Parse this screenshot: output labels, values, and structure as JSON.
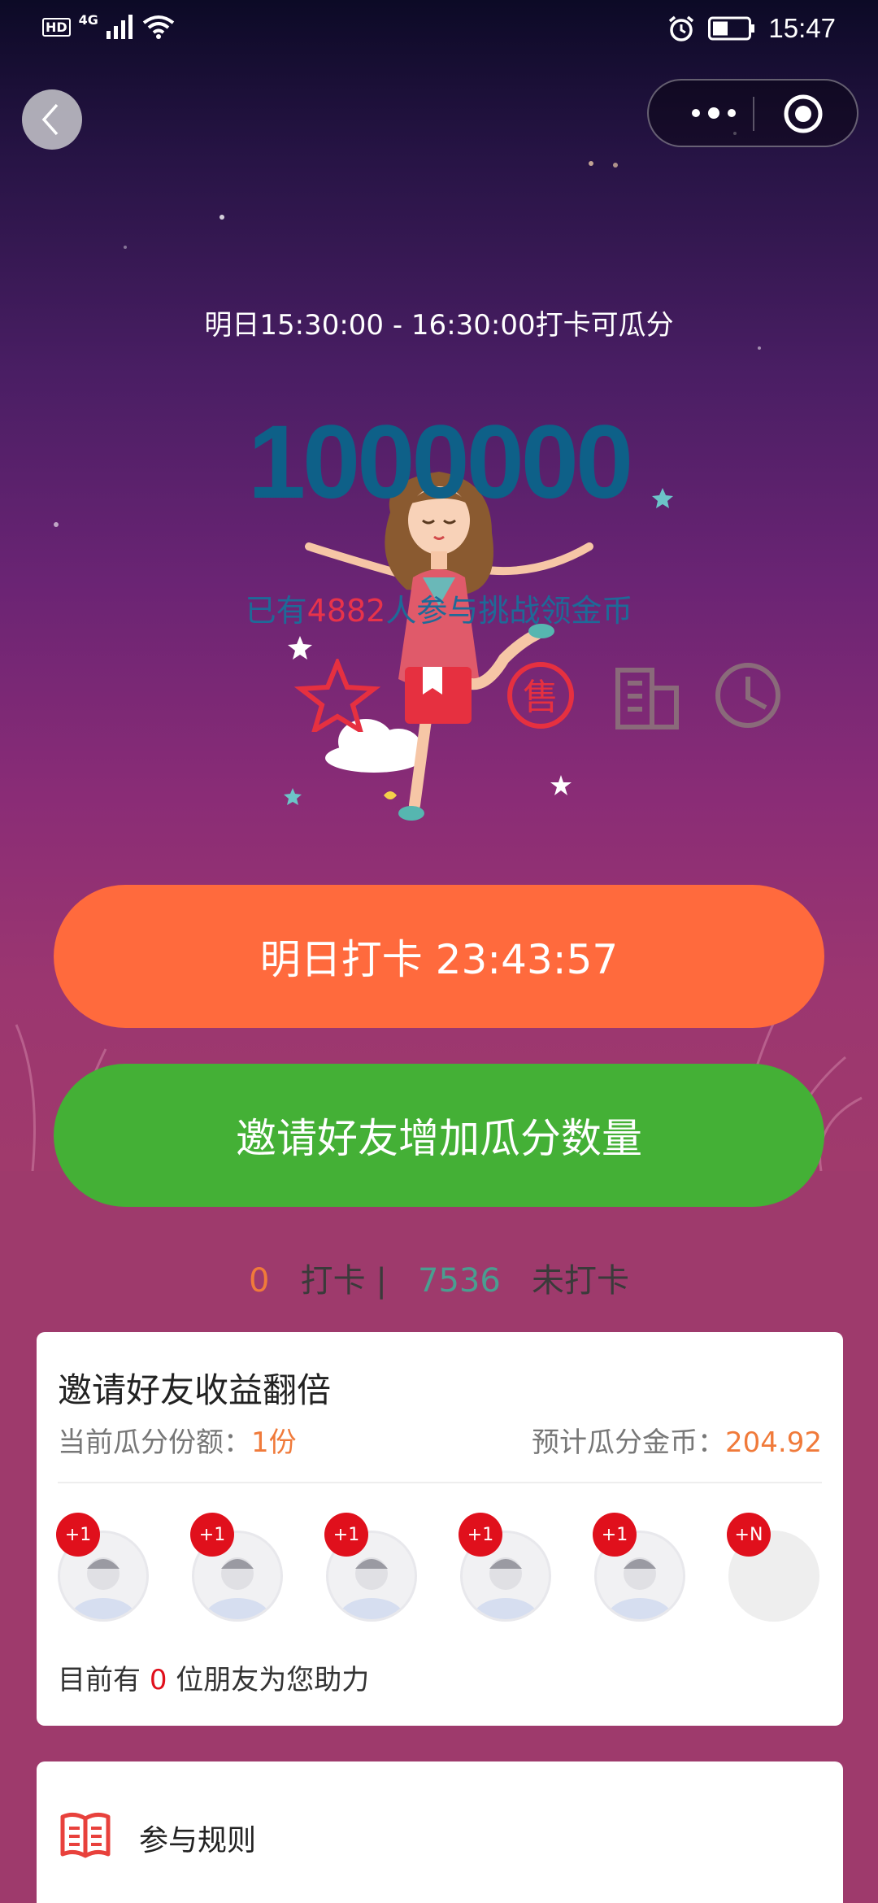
{
  "status_bar": {
    "time": "15:47",
    "hd_label": "HD",
    "network_label": "4G",
    "icons": [
      "signal-icon",
      "wifi-icon",
      "alarm-icon",
      "battery-icon"
    ]
  },
  "nav": {
    "back_icon": "chevron-left-icon",
    "menu_icon": "more-dots-icon",
    "close_icon": "target-circle-icon"
  },
  "hero": {
    "time_window": "明日15:30:00 - 16:30:00打卡可瓜分",
    "amount": "1000000",
    "participants_prefix": "已有",
    "participants_count": "4882",
    "participants_suffix": "人参与挑战领金币",
    "deco_icons": [
      "star-icon",
      "bookmark-icon",
      "sale-icon",
      "building-icon",
      "clock-icon"
    ],
    "colors": {
      "amount": "#0e6088",
      "participants": "#1e6a98",
      "count": "#e8334a"
    }
  },
  "buttons": {
    "checkin_label": "明日打卡 23:43:57",
    "invite_label": "邀请好友增加瓜分数量",
    "checkin_color": "#ff6a3d",
    "invite_color": "#44b036"
  },
  "stats": {
    "checked_count": "0",
    "checked_label": "打卡",
    "separator": "|",
    "unchecked_count": "7536",
    "unchecked_label": "未打卡"
  },
  "invite_card": {
    "title": "邀请好友收益翻倍",
    "share_label": "当前瓜分份额：",
    "share_value": "1份",
    "estimate_label": "预计瓜分金币：",
    "estimate_value": "204.92",
    "slots": [
      {
        "badge": "+1"
      },
      {
        "badge": "+1"
      },
      {
        "badge": "+1"
      },
      {
        "badge": "+1"
      },
      {
        "badge": "+1"
      },
      {
        "badge": "+N"
      }
    ],
    "helpers_prefix": "目前有",
    "helpers_count": "0",
    "helpers_suffix": "位朋友为您助力"
  },
  "rules": {
    "icon": "book-icon",
    "label": "参与规则"
  }
}
